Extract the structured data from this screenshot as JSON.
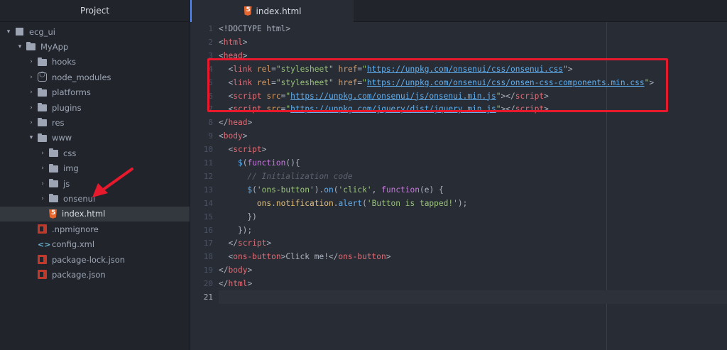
{
  "sidebar": {
    "title": "Project",
    "items": [
      {
        "label": "ecg_ui",
        "icon": "repo-icon",
        "depth": 0,
        "chevron": "▾"
      },
      {
        "label": "MyApp",
        "icon": "folder-icon",
        "depth": 1,
        "chevron": "▾"
      },
      {
        "label": "hooks",
        "icon": "folder-icon",
        "depth": 2,
        "chevron": "›"
      },
      {
        "label": "node_modules",
        "icon": "submodule-icon",
        "depth": 2,
        "chevron": "›"
      },
      {
        "label": "platforms",
        "icon": "folder-icon",
        "depth": 2,
        "chevron": "›"
      },
      {
        "label": "plugins",
        "icon": "folder-icon",
        "depth": 2,
        "chevron": "›"
      },
      {
        "label": "res",
        "icon": "folder-icon",
        "depth": 2,
        "chevron": "›"
      },
      {
        "label": "www",
        "icon": "folder-icon",
        "depth": 2,
        "chevron": "▾"
      },
      {
        "label": "css",
        "icon": "folder-icon",
        "depth": 3,
        "chevron": "›"
      },
      {
        "label": "img",
        "icon": "folder-icon",
        "depth": 3,
        "chevron": "›"
      },
      {
        "label": "js",
        "icon": "folder-icon",
        "depth": 3,
        "chevron": "›"
      },
      {
        "label": "onsenui",
        "icon": "folder-icon",
        "depth": 3,
        "chevron": "›"
      },
      {
        "label": "index.html",
        "icon": "html5-icon",
        "depth": 3,
        "chevron": "",
        "selected": true
      },
      {
        "label": ".npmignore",
        "icon": "npm-icon",
        "depth": 2,
        "chevron": ""
      },
      {
        "label": "config.xml",
        "icon": "code-icon",
        "depth": 2,
        "chevron": ""
      },
      {
        "label": "package-lock.json",
        "icon": "npm-icon",
        "depth": 2,
        "chevron": ""
      },
      {
        "label": "package.json",
        "icon": "npm-icon",
        "depth": 2,
        "chevron": ""
      }
    ]
  },
  "tab": {
    "label": "index.html",
    "icon": "html5-icon"
  },
  "editor": {
    "active_line": 21,
    "lines": [
      {
        "n": "1",
        "tokens": [
          [
            "t-pl",
            "<!DOCTYPE html>"
          ]
        ]
      },
      {
        "n": "2",
        "tokens": [
          [
            "t-pl",
            "<"
          ],
          [
            "t-tag",
            "html"
          ],
          [
            "t-pl",
            ">"
          ]
        ]
      },
      {
        "n": "3",
        "tokens": [
          [
            "t-pl",
            "<"
          ],
          [
            "t-tag",
            "head"
          ],
          [
            "t-pl",
            ">"
          ]
        ]
      },
      {
        "n": "4",
        "tokens": [
          [
            "t-pl",
            "  <"
          ],
          [
            "t-tag",
            "link"
          ],
          [
            "t-pl",
            " "
          ],
          [
            "t-attr",
            "rel"
          ],
          [
            "t-pl",
            "="
          ],
          [
            "t-str",
            "\"stylesheet\""
          ],
          [
            "t-pl",
            " "
          ],
          [
            "t-attr",
            "href"
          ],
          [
            "t-pl",
            "="
          ],
          [
            "t-str",
            "\""
          ],
          [
            "t-url",
            "https://unpkg.com/onsenui/css/onsenui.css"
          ],
          [
            "t-str",
            "\""
          ],
          [
            "t-pl",
            ">"
          ]
        ]
      },
      {
        "n": "5",
        "tokens": [
          [
            "t-pl",
            "  <"
          ],
          [
            "t-tag",
            "link"
          ],
          [
            "t-pl",
            " "
          ],
          [
            "t-attr",
            "rel"
          ],
          [
            "t-pl",
            "="
          ],
          [
            "t-str",
            "\"stylesheet\""
          ],
          [
            "t-pl",
            " "
          ],
          [
            "t-attr",
            "href"
          ],
          [
            "t-pl",
            "="
          ],
          [
            "t-str",
            "\""
          ],
          [
            "t-url",
            "https://unpkg.com/onsenui/css/onsen-css-components.min.css"
          ],
          [
            "t-str",
            "\""
          ],
          [
            "t-pl",
            ">"
          ]
        ]
      },
      {
        "n": "6",
        "tokens": [
          [
            "t-pl",
            "  <"
          ],
          [
            "t-tag",
            "script"
          ],
          [
            "t-pl",
            " "
          ],
          [
            "t-attr",
            "src"
          ],
          [
            "t-pl",
            "="
          ],
          [
            "t-str",
            "\""
          ],
          [
            "t-url",
            "https://unpkg.com/onsenui/js/onsenui.min.js"
          ],
          [
            "t-str",
            "\""
          ],
          [
            "t-pl",
            "></"
          ],
          [
            "t-tag",
            "script"
          ],
          [
            "t-pl",
            ">"
          ]
        ]
      },
      {
        "n": "7",
        "tokens": [
          [
            "t-pl",
            "  <"
          ],
          [
            "t-tag",
            "script"
          ],
          [
            "t-pl",
            " "
          ],
          [
            "t-attr",
            "src"
          ],
          [
            "t-pl",
            "="
          ],
          [
            "t-str",
            "\""
          ],
          [
            "t-url",
            "https://unpkg.com/jquery/dist/jquery.min.js"
          ],
          [
            "t-str",
            "\""
          ],
          [
            "t-pl",
            "></"
          ],
          [
            "t-tag",
            "script"
          ],
          [
            "t-pl",
            ">"
          ]
        ]
      },
      {
        "n": "8",
        "tokens": [
          [
            "t-pl",
            "</"
          ],
          [
            "t-tag",
            "head"
          ],
          [
            "t-pl",
            ">"
          ]
        ]
      },
      {
        "n": "9",
        "tokens": [
          [
            "t-pl",
            "<"
          ],
          [
            "t-tag",
            "body"
          ],
          [
            "t-pl",
            ">"
          ]
        ]
      },
      {
        "n": "10",
        "tokens": [
          [
            "t-pl",
            "  <"
          ],
          [
            "t-tag",
            "script"
          ],
          [
            "t-pl",
            ">"
          ]
        ]
      },
      {
        "n": "11",
        "tokens": [
          [
            "t-pl",
            "    "
          ],
          [
            "t-fn",
            "$"
          ],
          [
            "t-pl",
            "("
          ],
          [
            "t-kw",
            "function"
          ],
          [
            "t-pl",
            "(){"
          ]
        ]
      },
      {
        "n": "12",
        "tokens": [
          [
            "t-cm",
            "      // Initialization code"
          ]
        ]
      },
      {
        "n": "13",
        "tokens": [
          [
            "t-pl",
            "      "
          ],
          [
            "t-fn",
            "$"
          ],
          [
            "t-pl",
            "("
          ],
          [
            "t-str",
            "'ons-button'"
          ],
          [
            "t-pl",
            ")."
          ],
          [
            "t-fn",
            "on"
          ],
          [
            "t-pl",
            "("
          ],
          [
            "t-str",
            "'click'"
          ],
          [
            "t-pl",
            ", "
          ],
          [
            "t-kw",
            "function"
          ],
          [
            "t-pl",
            "(e) {"
          ]
        ]
      },
      {
        "n": "14",
        "tokens": [
          [
            "t-pl",
            "        "
          ],
          [
            "t-obj",
            "ons"
          ],
          [
            "t-pl",
            "."
          ],
          [
            "t-obj",
            "notification"
          ],
          [
            "t-pl",
            "."
          ],
          [
            "t-fn",
            "alert"
          ],
          [
            "t-pl",
            "("
          ],
          [
            "t-str",
            "'Button is tapped!'"
          ],
          [
            "t-pl",
            ");"
          ]
        ]
      },
      {
        "n": "15",
        "tokens": [
          [
            "t-pl",
            "      })"
          ]
        ]
      },
      {
        "n": "16",
        "tokens": [
          [
            "t-pl",
            "    });"
          ]
        ]
      },
      {
        "n": "17",
        "tokens": [
          [
            "t-pl",
            "  </"
          ],
          [
            "t-tag",
            "script"
          ],
          [
            "t-pl",
            ">"
          ]
        ]
      },
      {
        "n": "18",
        "tokens": [
          [
            "t-pl",
            "  <"
          ],
          [
            "t-tag",
            "ons-button"
          ],
          [
            "t-pl",
            ">Click me!</"
          ],
          [
            "t-tag",
            "ons-button"
          ],
          [
            "t-pl",
            ">"
          ]
        ]
      },
      {
        "n": "19",
        "tokens": [
          [
            "t-pl",
            "</"
          ],
          [
            "t-tag",
            "body"
          ],
          [
            "t-pl",
            ">"
          ]
        ]
      },
      {
        "n": "20",
        "tokens": [
          [
            "t-pl",
            "</"
          ],
          [
            "t-tag",
            "html"
          ],
          [
            "t-pl",
            ">"
          ]
        ]
      },
      {
        "n": "21",
        "tokens": []
      }
    ]
  },
  "annotations": {
    "box_color": "#e8192c",
    "arrow_color": "#e8192c"
  }
}
